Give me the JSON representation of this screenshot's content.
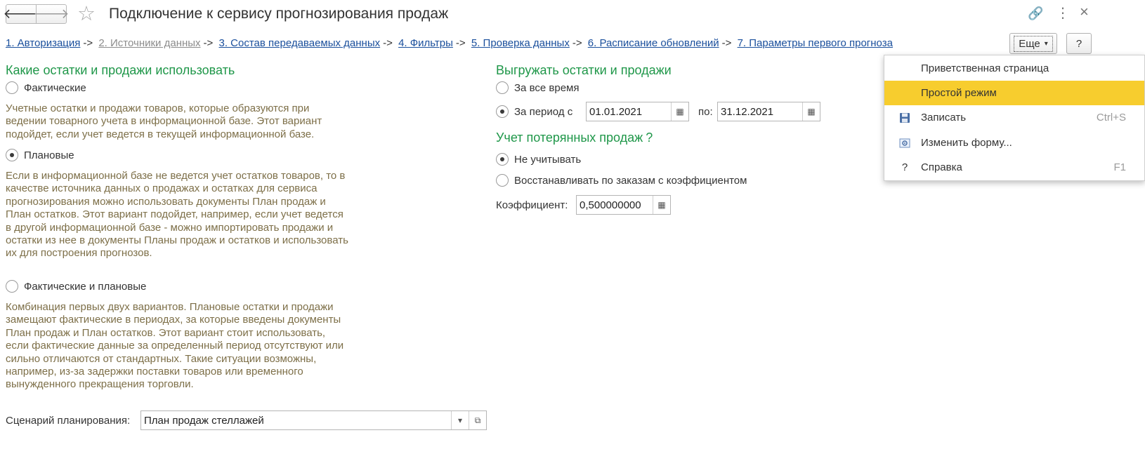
{
  "header": {
    "back_glyph": "🡐",
    "forward_glyph": "🡒",
    "star_glyph": "☆",
    "title": "Подключение к сервису прогнозирования продаж",
    "link_glyph": "🔗",
    "kebab_glyph": "⋮",
    "close_glyph": "×"
  },
  "steps": [
    {
      "label": "1. Авторизация"
    },
    {
      "label": "2. Источники данных"
    },
    {
      "label": "3. Состав передаваемых данных"
    },
    {
      "label": "4. Фильтры"
    },
    {
      "label": "5. Проверка данных"
    },
    {
      "label": "6. Расписание обновлений"
    },
    {
      "label": "7. Параметры первого прогноза"
    }
  ],
  "step_separator": "->",
  "toolbar": {
    "more_label": "Еще",
    "more_arrow": "▾",
    "help_label": "?"
  },
  "left": {
    "heading": "Какие остатки и продажи использовать",
    "options": [
      {
        "label": "Фактические",
        "selected": false,
        "desc": "Учетные остатки и продажи товаров, которые образуются при ведении товарного учета в информационной базе. Этот вариант подойдет, если учет ведется в текущей информационной базе."
      },
      {
        "label": "Плановые",
        "selected": true,
        "desc": "Если в информационной базе не ведется учет остатков товаров, то в качестве источника данных о продажах и остатках для сервиса прогнозирования можно использовать документы План продаж и План остатков. Этот вариант подойдет, например, если учет ведется в другой информационной базе - можно импортировать продажи и остатки из нее в документы Планы продаж и остатков и использовать их для построения прогнозов."
      },
      {
        "label": "Фактические и плановые",
        "selected": false,
        "desc": "Комбинация первых двух вариантов. Плановые остатки и продажи замещают фактические в периодах, за которые введены документы План продаж и План остатков. Этот вариант стоит использовать, если фактические данные за определенный период отсутствуют или сильно отличаются от стандартных. Такие ситуации возможны, например, из-за задержки поставки товаров или временного вынужденного прекращения торговли."
      }
    ],
    "scenario_label": "Сценарий планирования:",
    "scenario_value": "План продаж стеллажей",
    "scenario_dropdown_glyph": "▾",
    "scenario_open_glyph": "⧉"
  },
  "right": {
    "export_heading": "Выгружать остатки и продажи",
    "all_time_label": "За все время",
    "all_time_selected": false,
    "period_label": "За период с",
    "period_selected": true,
    "date_from": "01.01.2021",
    "to_label": "по:",
    "date_to": "31.12.2021",
    "calendar_glyph": "▦",
    "lost_heading": "Учет потерянных продаж",
    "lost_help": "?",
    "ignore_label": "Не учитывать",
    "ignore_selected": true,
    "restore_label": "Восстанавливать по заказам с коэффициентом",
    "restore_selected": false,
    "coef_label": "Коэффициент:",
    "coef_value": "0,500000000",
    "calc_glyph": "▦"
  },
  "menu": {
    "items": [
      {
        "label": "Приветственная страница",
        "icon": "",
        "shortcut": "",
        "highlighted": false
      },
      {
        "label": "Простой режим",
        "icon": "",
        "shortcut": "",
        "highlighted": true
      },
      {
        "label": "Записать",
        "icon": "💾",
        "shortcut": "Ctrl+S",
        "highlighted": false
      },
      {
        "label": "Изменить форму...",
        "icon": "⚙",
        "shortcut": "",
        "highlighted": false
      },
      {
        "label": "Справка",
        "icon": "?",
        "shortcut": "F1",
        "highlighted": false
      }
    ]
  },
  "colors": {
    "section_heading": "#1f9749",
    "description_text": "#7d6f48",
    "link": "#1a4f9c",
    "highlight": "#f7cd2e"
  }
}
